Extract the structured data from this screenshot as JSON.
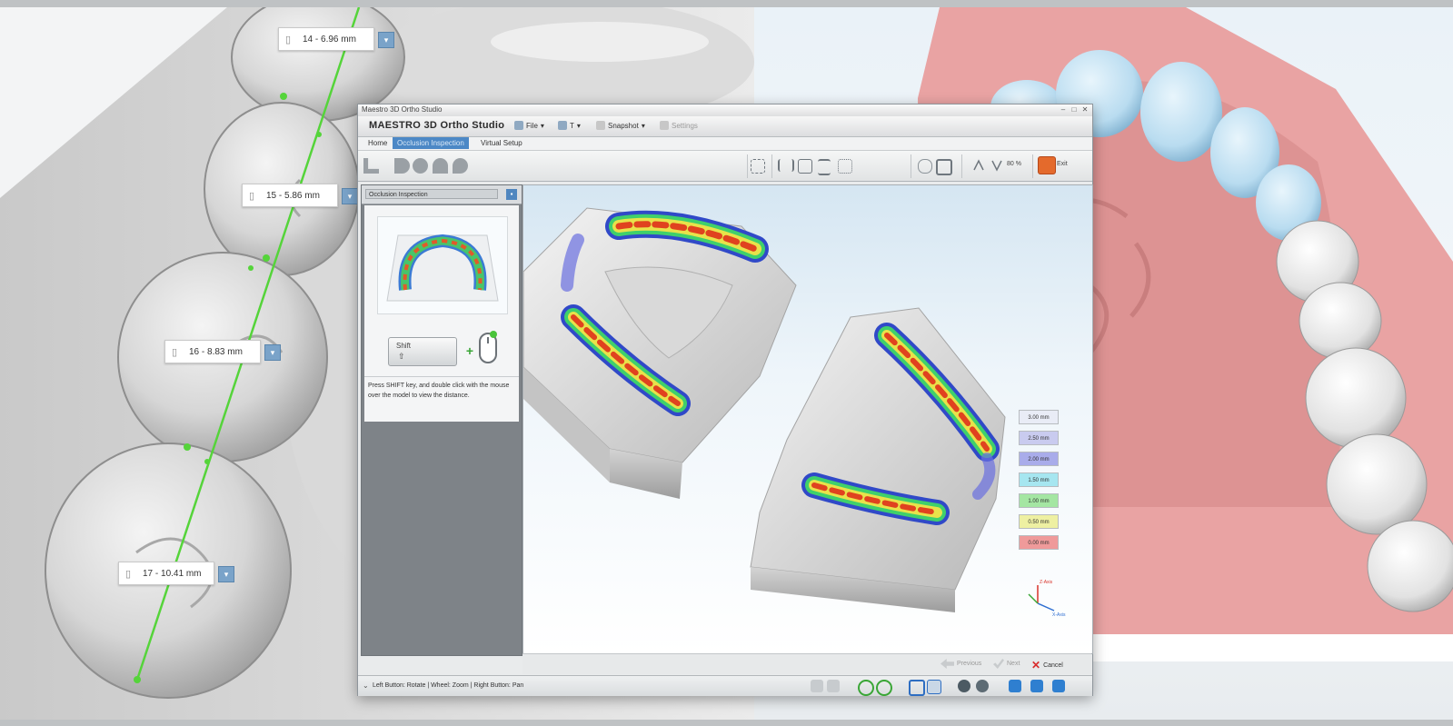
{
  "measurements": [
    {
      "label": "14 - 6.96 mm"
    },
    {
      "label": "15 - 5.86 mm"
    },
    {
      "label": "16 - 8.83 mm"
    },
    {
      "label": "17 - 10.41 mm"
    }
  ],
  "window": {
    "title": "Maestro 3D Ortho Studio",
    "brand": "MAESTRO 3D Ortho Studio",
    "header_items": [
      "File",
      "T",
      "Snapshot",
      "Settings"
    ]
  },
  "nav_tabs": [
    "Home",
    "Occlusion Inspection",
    "Virtual Setup"
  ],
  "panel": {
    "title": "Occlusion Inspection",
    "shift_key": "Shift",
    "shift_arrow": "⇧",
    "instruction": "Press SHIFT key, and double click with the mouse over the model to view the distance."
  },
  "legend": [
    {
      "label": "3.00 mm",
      "color": "#e9ecf6"
    },
    {
      "label": "2.50 mm",
      "color": "#c9cbef"
    },
    {
      "label": "2.00 mm",
      "color": "#a9acea"
    },
    {
      "label": "1.50 mm",
      "color": "#a6e6f0"
    },
    {
      "label": "1.00 mm",
      "color": "#a4e6a2"
    },
    {
      "label": "0.50 mm",
      "color": "#eef0a2"
    },
    {
      "label": "0.00 mm",
      "color": "#ef9a9a"
    }
  ],
  "wizard": {
    "previous": "Previous",
    "next": "Next",
    "cancel": "Cancel"
  },
  "status_text": "Left Button: Rotate | Wheel: Zoom | Right Button: Pan",
  "toolbar": {
    "zoom_label": "80 %",
    "exit_label": "Exit"
  },
  "axes": {
    "x": "X-Axis",
    "z": "Z-Axis"
  },
  "colors": {
    "accent": "#4c88c6",
    "gum": "#e9a3a3",
    "aligner": "#bfe0f2",
    "measure_line": "#55d43a"
  }
}
